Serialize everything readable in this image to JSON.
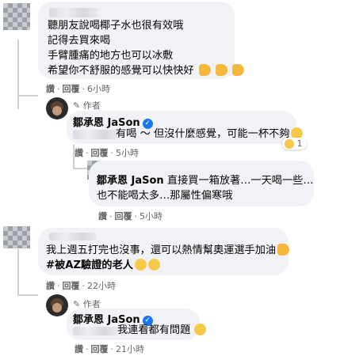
{
  "comments": [
    {
      "lines": [
        "聽朋友說喝椰子水也很有效哦",
        "記得去買來喝",
        "手臂腫痛的地方也可以冰敷",
        "希望你不舒服的感覺可以快快好"
      ],
      "like": "讚",
      "reply": "回覆",
      "time": "6小時",
      "emoji": "muscle-emoji"
    },
    {
      "badge": "作者",
      "name": "鄒承恩 JaSon",
      "text": "有喝 ～ 但沒什麼感覺，可能一杯不夠",
      "like": "讚",
      "reply": "回覆",
      "time": "5小時",
      "reaction_count": "1"
    },
    {
      "name": "鄒承恩 JaSon",
      "lines": [
        "直接買一箱放著…一天喝一些…",
        "也不能喝太多…那屬性偏寒哦"
      ],
      "like": "讚",
      "reply": "回覆",
      "time": "5小時"
    },
    {
      "lines": [
        "我上週五打完也沒事，還可以熱情幫奧運選手加油",
        "#被AZ驗證的老人"
      ],
      "like": "讚",
      "reply": "回覆",
      "time": "22小時"
    },
    {
      "badge": "作者",
      "name": "鄒承恩 JaSon",
      "text": "我連看都有問題",
      "like": "讚",
      "reply": "回覆",
      "time": "21小時"
    }
  ],
  "separator": "·",
  "verified_symbol": "✓"
}
